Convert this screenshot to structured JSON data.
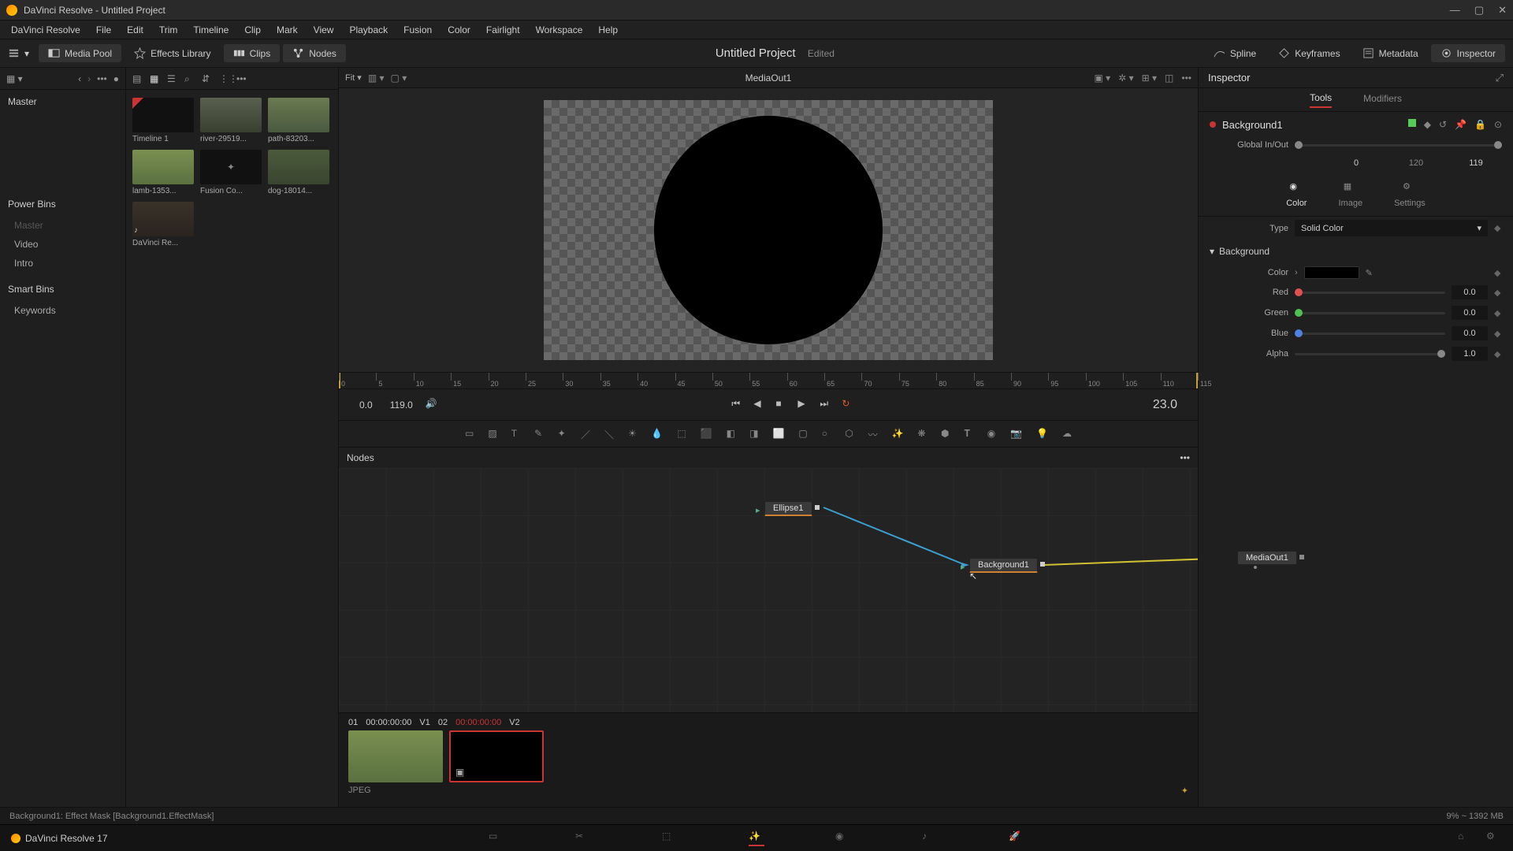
{
  "window": {
    "title": "DaVinci Resolve - Untitled Project"
  },
  "menu": [
    "DaVinci Resolve",
    "File",
    "Edit",
    "Trim",
    "Timeline",
    "Clip",
    "Mark",
    "View",
    "Playback",
    "Fusion",
    "Color",
    "Fairlight",
    "Workspace",
    "Help"
  ],
  "toolbar": {
    "left": [
      {
        "label": "Media Pool",
        "active": true
      },
      {
        "label": "Effects Library",
        "active": false
      },
      {
        "label": "Clips",
        "active": true
      },
      {
        "label": "Nodes",
        "active": true
      }
    ],
    "project_title": "Untitled Project",
    "edited": "Edited",
    "right": [
      {
        "label": "Spline"
      },
      {
        "label": "Keyframes"
      },
      {
        "label": "Metadata"
      },
      {
        "label": "Inspector",
        "active": true
      }
    ]
  },
  "media_sidebar": {
    "master": "Master",
    "powerbins": "Power Bins",
    "powerbins_items": [
      "Master",
      "Video",
      "Intro"
    ],
    "smartbins": "Smart Bins",
    "smartbins_items": [
      "Keywords"
    ]
  },
  "media_tools": {
    "fit": "Fit",
    "dots": "•••"
  },
  "clips": [
    {
      "name": "Timeline 1",
      "bg": "#111",
      "corner": "#cc3333"
    },
    {
      "name": "river-29519...",
      "bg": "linear-gradient(#5a6050,#3a4030)"
    },
    {
      "name": "path-83203...",
      "bg": "linear-gradient(#6a7a50,#4a5a40)"
    },
    {
      "name": "lamb-1353...",
      "bg": "linear-gradient(#7a9050,#5a7040)"
    },
    {
      "name": "Fusion Co...",
      "bg": "#111"
    },
    {
      "name": "dog-18014...",
      "bg": "linear-gradient(#4a5a3a,#3a4530)"
    },
    {
      "name": "DaVinci Re...",
      "bg": "linear-gradient(#3a3228,#2a2420)"
    }
  ],
  "viewer": {
    "name": "MediaOut1"
  },
  "ruler_ticks": [
    0,
    5,
    10,
    15,
    20,
    25,
    30,
    35,
    40,
    45,
    50,
    55,
    60,
    65,
    70,
    75,
    80,
    85,
    90,
    95,
    100,
    105,
    110,
    115
  ],
  "transport": {
    "in": "0.0",
    "out": "119.0",
    "current": "23.0"
  },
  "global_io": {
    "label": "Global In/Out",
    "in": "0",
    "mid": "120",
    "out": "119"
  },
  "nodes_header": "Nodes",
  "nodes": {
    "ellipse": "Ellipse1",
    "background": "Background1",
    "mediaout": "MediaOut1"
  },
  "clips_bar": {
    "c1_idx": "01",
    "c1_tc": "00:00:00:00",
    "c1_track": "V1",
    "c2_idx": "02",
    "c2_tc": "00:00:00:00",
    "c2_track": "V2",
    "format": "JPEG"
  },
  "status": {
    "left": "Background1: Effect Mask    [Background1.EffectMask]",
    "right": "9% ~ 1392 MB"
  },
  "footer": {
    "app": "DaVinci Resolve 17"
  },
  "inspector": {
    "title": "Inspector",
    "tabs": [
      "Tools",
      "Modifiers"
    ],
    "node": "Background1",
    "subtabs": [
      "Color",
      "Image",
      "Settings"
    ],
    "type_label": "Type",
    "type_value": "Solid Color",
    "bg_section": "Background",
    "color_label": "Color",
    "channels": [
      {
        "name": "Red",
        "value": "0.0",
        "color": "#e05050"
      },
      {
        "name": "Green",
        "value": "0.0",
        "color": "#50c050"
      },
      {
        "name": "Blue",
        "value": "0.0",
        "color": "#5080e0"
      },
      {
        "name": "Alpha",
        "value": "1.0",
        "color": "#ccc"
      }
    ]
  }
}
